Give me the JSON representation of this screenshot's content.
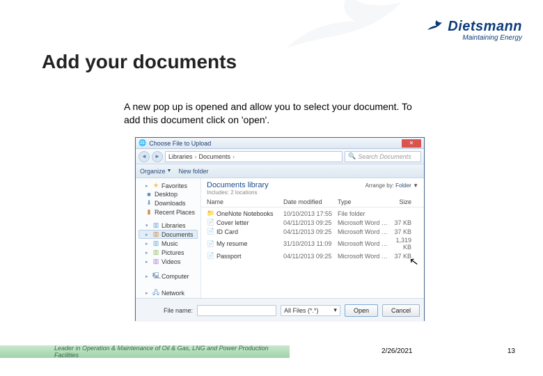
{
  "slide": {
    "title": "Add your documents",
    "body": "A new pop up is opened and allow you to select your document. To add this document click on 'open'.",
    "footer_tagline": "Leader in Operation & Maintenance of Oil & Gas, LNG and Power Production Facilities",
    "date": "2/26/2021",
    "page": "13"
  },
  "brand": {
    "name": "Dietsmann",
    "tagline": "Maintaining Energy"
  },
  "dialog": {
    "title": "Choose File to Upload",
    "breadcrumb": {
      "root": "Libraries",
      "current": "Documents"
    },
    "search_placeholder": "Search Documents",
    "toolbar": {
      "organize": "Organize",
      "newfolder": "New folder"
    },
    "sidebar": {
      "favorites_label": "Favorites",
      "favorites": [
        {
          "label": "Desktop"
        },
        {
          "label": "Downloads"
        },
        {
          "label": "Recent Places"
        }
      ],
      "libraries_label": "Libraries",
      "libraries": [
        {
          "label": "Documents"
        },
        {
          "label": "Music"
        },
        {
          "label": "Pictures"
        },
        {
          "label": "Videos"
        }
      ],
      "computer_label": "Computer",
      "network_label": "Network"
    },
    "main": {
      "heading": "Documents library",
      "subheading": "Includes: 2 locations",
      "arrange_label": "Arrange by:",
      "arrange_value": "Folder",
      "columns": {
        "name": "Name",
        "date": "Date modified",
        "type": "Type",
        "size": "Size"
      },
      "rows": [
        {
          "icon": "folder",
          "name": "OneNote Notebooks",
          "date": "10/10/2013 17:55",
          "type": "File folder",
          "size": ""
        },
        {
          "icon": "doc",
          "name": "Cover letter",
          "date": "04/11/2013 09:25",
          "type": "Microsoft Word D…",
          "size": "37 KB"
        },
        {
          "icon": "doc",
          "name": "ID Card",
          "date": "04/11/2013 09:25",
          "type": "Microsoft Word D…",
          "size": "37 KB"
        },
        {
          "icon": "doc",
          "name": "My resume",
          "date": "31/10/2013 11:09",
          "type": "Microsoft Word D…",
          "size": "1,319 KB"
        },
        {
          "icon": "doc",
          "name": "Passport",
          "date": "04/11/2013 09:25",
          "type": "Microsoft Word D…",
          "size": "37 KB"
        }
      ]
    },
    "footer": {
      "filename_label": "File name:",
      "filetype_value": "All Files (*.*)",
      "open": "Open",
      "cancel": "Cancel"
    }
  }
}
